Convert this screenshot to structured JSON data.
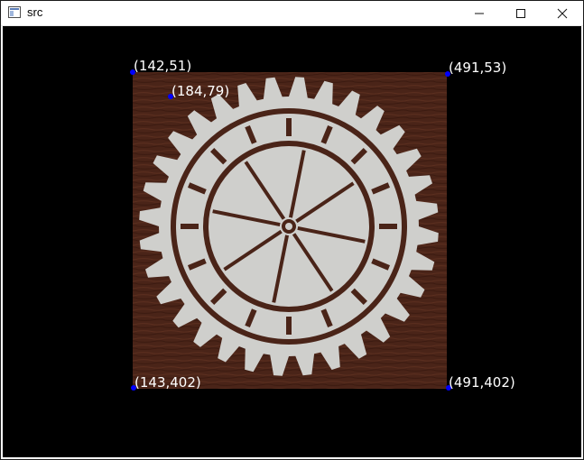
{
  "window": {
    "title": "src",
    "icon": "app-window-icon",
    "controls": [
      "minimize-icon",
      "maximize-icon",
      "close-icon"
    ]
  },
  "image": {
    "background_color": "#000000",
    "wood_color": "#4a2418",
    "gear_color": "#cfcfcc",
    "marker_color": "#0000ff",
    "label_color": "#ffffff"
  },
  "points": {
    "top_left": "(142,51)",
    "top_right": "(491,53)",
    "inner": "(184,79)",
    "bottom_left": "(143,402)",
    "bottom_right": "(491,402)"
  }
}
